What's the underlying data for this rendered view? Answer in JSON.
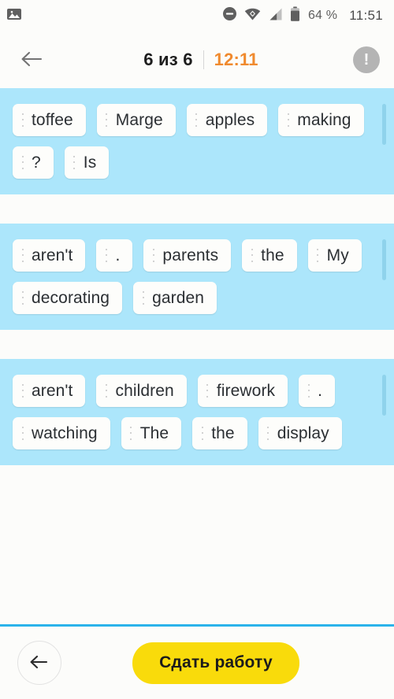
{
  "statusbar": {
    "left_icon": "image-icon",
    "icons": [
      "do-not-disturb-icon",
      "wifi-icon",
      "cellular-signal-icon",
      "battery-icon"
    ],
    "battery_percent": "64 %",
    "clock": "11:51"
  },
  "header": {
    "back_icon": "arrow-left-icon",
    "progress": "6 из 6",
    "timer": "12:11",
    "info_icon": "exclamation-circle-icon",
    "info_mark": "!"
  },
  "tasks": [
    {
      "id": "task-1",
      "chips": [
        "toffee",
        "Marge",
        "apples",
        "making",
        "?",
        "Is"
      ]
    },
    {
      "id": "task-2",
      "chips": [
        "aren't",
        ".",
        "parents",
        "the",
        "My",
        "decorating",
        "garden"
      ]
    },
    {
      "id": "task-3",
      "chips": [
        "aren't",
        "children",
        "firework",
        ".",
        "watching",
        "The",
        "the",
        "display"
      ]
    }
  ],
  "footer": {
    "back_icon": "arrow-left-icon",
    "submit_label": "Сдать работу"
  },
  "colors": {
    "card_background": "#ACE6FB",
    "chip_background": "#FDFDFB",
    "accent_yellow": "#F9DB0B",
    "accent_orange": "#F08A2E",
    "divider_blue": "#2BB3EA",
    "page_background": "#FCFCFA"
  }
}
